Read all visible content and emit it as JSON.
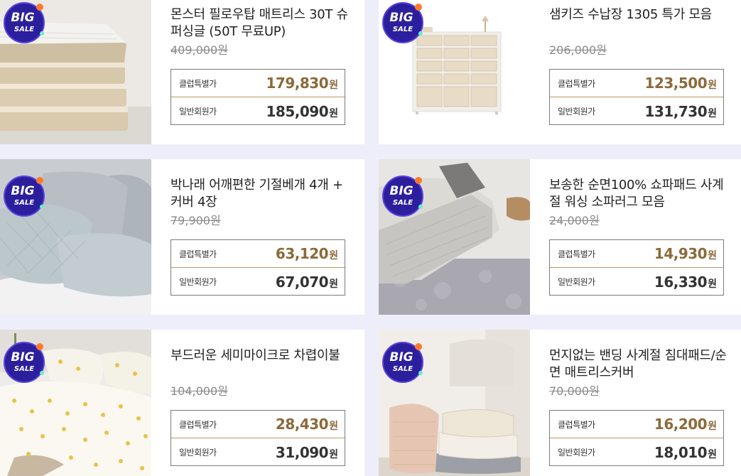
{
  "badge": {
    "line1": "BIG",
    "line2": "SALE"
  },
  "labels": {
    "club": "클럽특별가",
    "member": "일반회원가"
  },
  "products": [
    {
      "title": "몬스터 필로우탑 매트리스 30T 슈퍼싱글 (50T 무료UP)",
      "original_price": "409,000원",
      "club_price": "179,830",
      "member_price": "185,090",
      "currency": "원",
      "image": "mattress-stack"
    },
    {
      "title": "샘키즈 수납장 1305 특가 모음",
      "original_price": "206,000원",
      "club_price": "123,500",
      "member_price": "131,730",
      "currency": "원",
      "image": "storage-drawer-cabinet"
    },
    {
      "title": "박나래 어깨편한 기절베개 4개 + 커버 4장",
      "original_price": "79,900원",
      "club_price": "63,120",
      "member_price": "67,070",
      "currency": "원",
      "image": "quilted-pillows"
    },
    {
      "title": "보송한 순면100% 쇼파패드 사계절 워싱 소파러그 모음",
      "original_price": "24,000원",
      "club_price": "14,930",
      "member_price": "16,330",
      "currency": "원",
      "image": "sofa-pad"
    },
    {
      "title": "부드러운 세미마이크로 차렵이불",
      "original_price": "104,000원",
      "club_price": "28,430",
      "member_price": "31,090",
      "currency": "원",
      "image": "dotted-comforter"
    },
    {
      "title": "먼지없는 밴딩 사계절 침대패드/순면 매트리스커버",
      "original_price": "70,000원",
      "club_price": "16,200",
      "member_price": "18,010",
      "currency": "원",
      "image": "folded-bed-pads"
    }
  ]
}
